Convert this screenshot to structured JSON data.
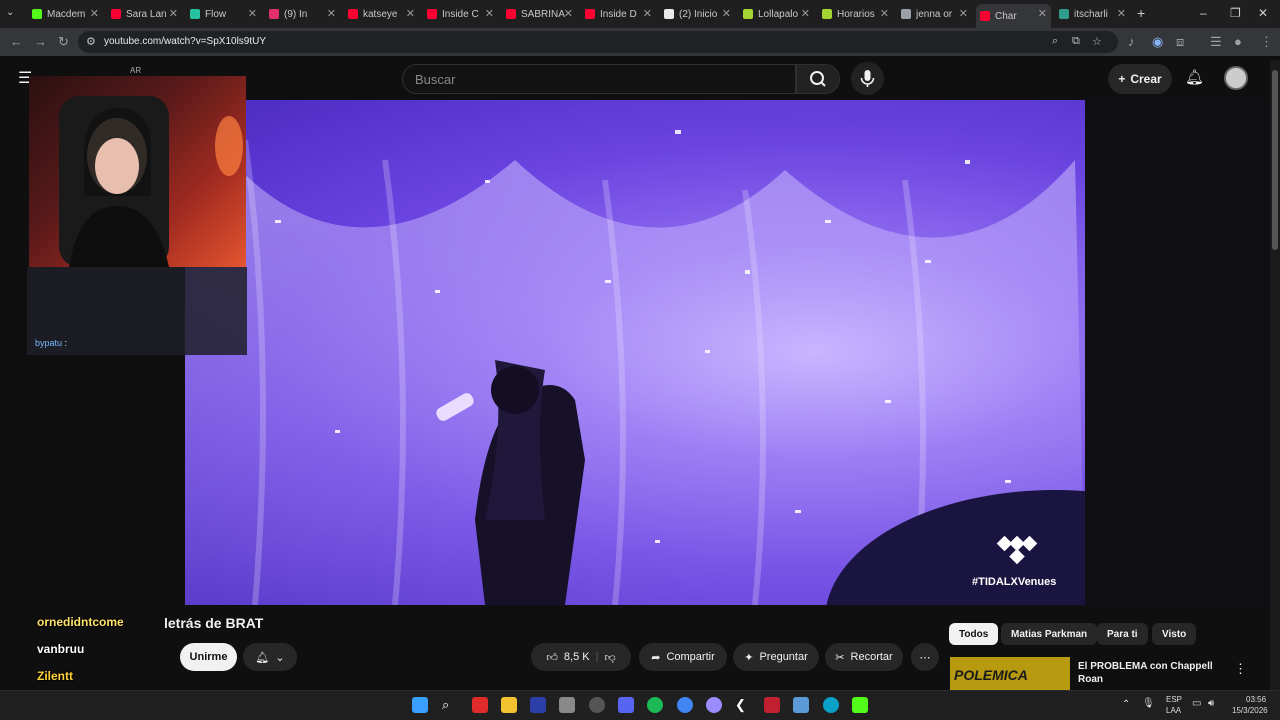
{
  "browser": {
    "tabs": [
      {
        "label": "Macdem",
        "color": "#53fc18"
      },
      {
        "label": "Sara Lan",
        "color": "#ff0033"
      },
      {
        "label": "Flow",
        "color": "#27c2a0"
      },
      {
        "label": "(9) In",
        "color": "#e1306c"
      },
      {
        "label": "katseye",
        "color": "#ff0033"
      },
      {
        "label": "Inside C",
        "color": "#ff0033"
      },
      {
        "label": "SABRINA",
        "color": "#ff0033"
      },
      {
        "label": "Inside D",
        "color": "#ff0033"
      },
      {
        "label": "(2) Inicio",
        "color": "#e7e9ea"
      },
      {
        "label": "Lollapalo",
        "color": "#a6d432"
      },
      {
        "label": "Horarios",
        "color": "#a6d432"
      },
      {
        "label": "jenna or",
        "color": "#9aa0a6"
      },
      {
        "label": "Char",
        "color": "#ff0033"
      },
      {
        "label": "itscharli",
        "color": "#2e9e8a"
      }
    ],
    "url": "youtube.com/watch?v=SpX10ls9tUY"
  },
  "youtube": {
    "logo_region": "AR",
    "search_placeholder": "Buscar",
    "create_label": "Crear"
  },
  "overlay": {
    "chat_user": "bypatu",
    "names": [
      "ornedidntcome",
      "vanbruu",
      "Zilentt"
    ]
  },
  "video": {
    "watermark": "#TIDALXVenues",
    "title": "letrás de BRAT"
  },
  "actions": {
    "join_label": "Unirme",
    "likes": "8,5 K",
    "share_label": "Compartir",
    "ask_label": "Preguntar",
    "clip_label": "Recortar"
  },
  "chips": [
    "Todos",
    "Matias Parkman",
    "Para ti",
    "Visto"
  ],
  "recommendation": {
    "title": "El PROBLEMA con Chappell",
    "title_line2": "Roan",
    "thumb_text": "POLEMICA"
  },
  "taskbar": {
    "lang": "ESP",
    "lang2": "LAA",
    "time": "03:56",
    "date": "15/3/2026"
  }
}
